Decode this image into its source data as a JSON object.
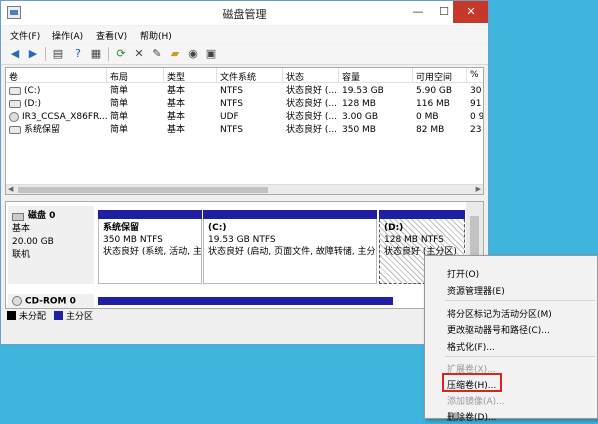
{
  "window": {
    "title": "磁盘管理",
    "min_glyph": "—",
    "max_glyph": "☐",
    "close_glyph": "✕"
  },
  "menubar": {
    "file": "文件(F)",
    "action": "操作(A)",
    "view": "查看(V)",
    "help": "帮助(H)"
  },
  "toolbar": {
    "icons": [
      "back-icon",
      "forward-icon",
      "console-tree-icon",
      "help-icon",
      "properties-icon",
      "refresh-icon",
      "delete-icon",
      "new-icon",
      "open-folder-icon",
      "search-icon",
      "settings-icon"
    ]
  },
  "volume_list": {
    "columns": [
      "卷",
      "布局",
      "类型",
      "文件系统",
      "状态",
      "容量",
      "可用空间",
      "%"
    ],
    "rows": [
      {
        "volume": "(C:)",
        "layout": "简单",
        "type": "基本",
        "fs": "NTFS",
        "status": "状态良好 (...",
        "capacity": "19.53 GB",
        "free": "5.90 GB",
        "pct": "30"
      },
      {
        "volume": "(D:)",
        "layout": "简单",
        "type": "基本",
        "fs": "NTFS",
        "status": "状态良好 (...",
        "capacity": "128 MB",
        "free": "116 MB",
        "pct": "91"
      },
      {
        "volume": "IR3_CCSA_X86FR...",
        "layout": "简单",
        "type": "基本",
        "fs": "UDF",
        "status": "状态良好 (...",
        "capacity": "3.00 GB",
        "free": "0 MB",
        "pct": "0 9"
      },
      {
        "volume": "系统保留",
        "layout": "简单",
        "type": "基本",
        "fs": "NTFS",
        "status": "状态良好 (...",
        "capacity": "350 MB",
        "free": "82 MB",
        "pct": "23"
      }
    ]
  },
  "disk0": {
    "name": "磁盘 0",
    "type": "基本",
    "size": "20.00 GB",
    "state": "联机",
    "partitions": [
      {
        "title": "系统保留",
        "size": "350 MB NTFS",
        "status": "状态良好 (系统, 活动, 主"
      },
      {
        "title": "(C:)",
        "size": "19.53 GB NTFS",
        "status": "状态良好 (启动, 页面文件, 故障转储, 主分"
      },
      {
        "title": "(D:)",
        "size": "128 MB NTFS",
        "status": "状态良好 (主分区)"
      }
    ]
  },
  "cdrom": {
    "name": "CD-ROM 0"
  },
  "legend": {
    "unallocated": "未分配",
    "primary": "主分区",
    "unallocated_color": "#000000",
    "primary_color": "#1f1fa3"
  },
  "context_menu": {
    "open": "打开(O)",
    "explore": "资源管理器(E)",
    "mark_active": "将分区标记为活动分区(M)",
    "change_letter": "更改驱动器号和路径(C)...",
    "format": "格式化(F)...",
    "extend": "扩展卷(X)...",
    "shrink": "压缩卷(H)...",
    "add_mirror": "添加镜像(A)...",
    "delete": "删除卷(D)..."
  },
  "colors": {
    "desktop": "#3fb4dd",
    "partition_bar": "#1f1fa3",
    "highlight_box": "#d6261d"
  }
}
